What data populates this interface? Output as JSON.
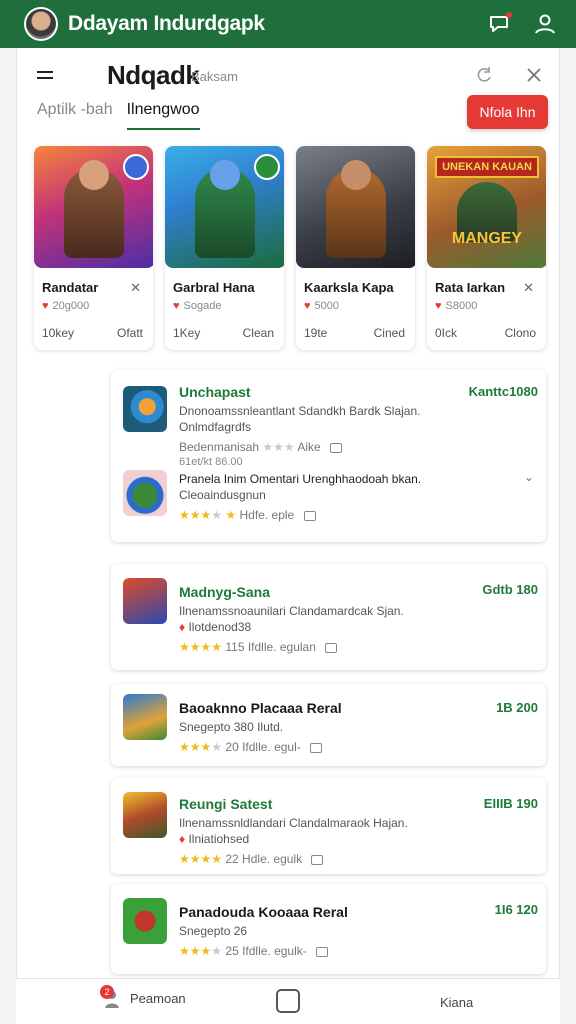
{
  "appbar": {
    "title": "Ddayam Indurdgapk",
    "profile_icon": "user-icon",
    "chat_icon": "chat-icon"
  },
  "header": {
    "title": "Ndqadk",
    "subtitle": "Baksam",
    "menu_icon": "menu-icon",
    "refresh_icon": "refresh-icon",
    "close_icon": "close-icon"
  },
  "tabs": [
    {
      "label": "Aptilk -bah",
      "active": false
    },
    {
      "label": "Ilnengwoo",
      "active": true
    }
  ],
  "cta_label": "Nfola Ihn",
  "featured": [
    {
      "name": "Randatar",
      "meta": "20g000",
      "left": "10key",
      "right": "Ofatt",
      "palette": "mage"
    },
    {
      "name": "Garbral Hana",
      "meta": "Sogade",
      "left": "1Key",
      "right": "Clean",
      "palette": "warrior"
    },
    {
      "name": "Kaarksla Kapa",
      "meta": "5000",
      "left": "19te",
      "right": "Cined",
      "palette": "guitar"
    },
    {
      "name": "Rata Iarkan",
      "meta": "S8000",
      "left": "0Ick",
      "right": "Clono",
      "palette": "squad",
      "banner": "UNEKAN KAUAN",
      "banner2": "MANGEY"
    }
  ],
  "list": [
    {
      "name": "Unchapast",
      "price": "Kanttc1080",
      "desc": "Dnonoamssnleantlant Sdandkh Bardk Slajan.",
      "desc2": "Onlmdfagrdfs",
      "rating_text": "Bedenmanisah",
      "extra": "Aike",
      "sub_meta": "61et/kt 86.00",
      "sub_name": "Pranela Inim Omentari Urenghhaodoah bkan.",
      "sub_desc": "Cleoaindusgnun",
      "sub_rating_text": "Hdfe. eple",
      "rating": 3.5
    },
    {
      "name": "Madnyg-Sana",
      "price": "Gdtb 180",
      "desc": "Ilnenamssnoaunilari Clandamardcak Sjan.",
      "desc2": "Ilotdenod38",
      "rating_text": "115 Ifdlle. egulan",
      "rating": 4
    },
    {
      "name": "Baoaknno Placaaa Reral",
      "price": "1B 200",
      "desc": "Snegepto 380 Ilutd.",
      "rating_text": "20 Ifdlle. egul-",
      "rating": 3
    },
    {
      "name": "Reungi Satest",
      "price": "EIIIB 190",
      "desc": "Ilnenamssnldlandari Clandalmaraok Hajan.",
      "desc2": "Ilniatiohsed",
      "rating_text": "22 Hdle. egulk",
      "rating": 4
    },
    {
      "name": "Panadouda Kooaaa Reral",
      "price": "1I6 120",
      "desc": "Snegepto 26",
      "rating_text": "25 Ifdlle. egulk-",
      "rating": 3
    }
  ],
  "bottom_nav": {
    "left_label": "Peamoan",
    "left_badge": "2",
    "right_label": "Kiana"
  },
  "colors": {
    "brand_green": "#1e6f3b",
    "accent_red": "#e53935",
    "star": "#f3b81c"
  }
}
